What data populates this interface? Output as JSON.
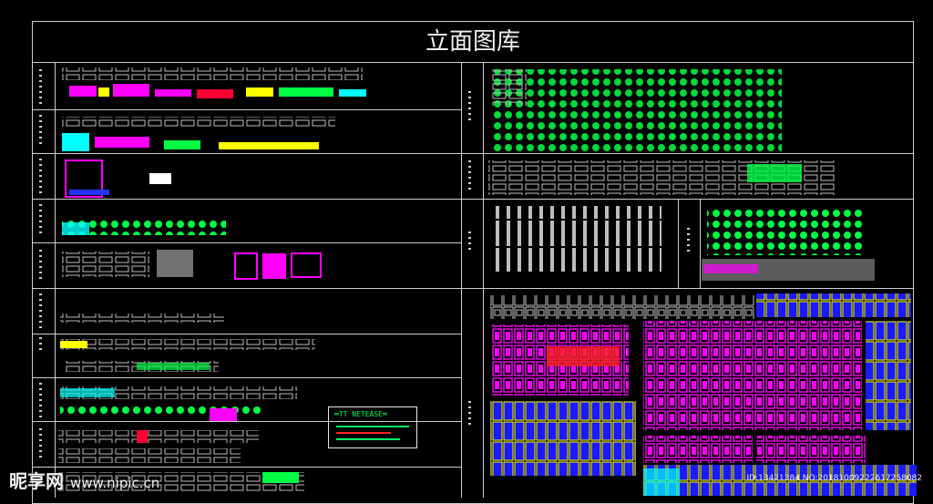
{
  "drawing": {
    "title": "立面图库",
    "colors": {
      "frame": "#cfcfcf",
      "accent_green": "#00ff66",
      "magenta": "#ff00ff",
      "blue": "#2233ff",
      "yellow": "#ffff00",
      "cyan": "#00ffff",
      "gray": "#9a9a9a",
      "red": "#ff2222"
    }
  },
  "legend": {
    "heading": "═TT  NETEASE═"
  },
  "watermark": {
    "logo": "昵享网",
    "url": "www.nipic.cn"
  },
  "image_id": "ID:13421384 NO:20181009222617258082"
}
